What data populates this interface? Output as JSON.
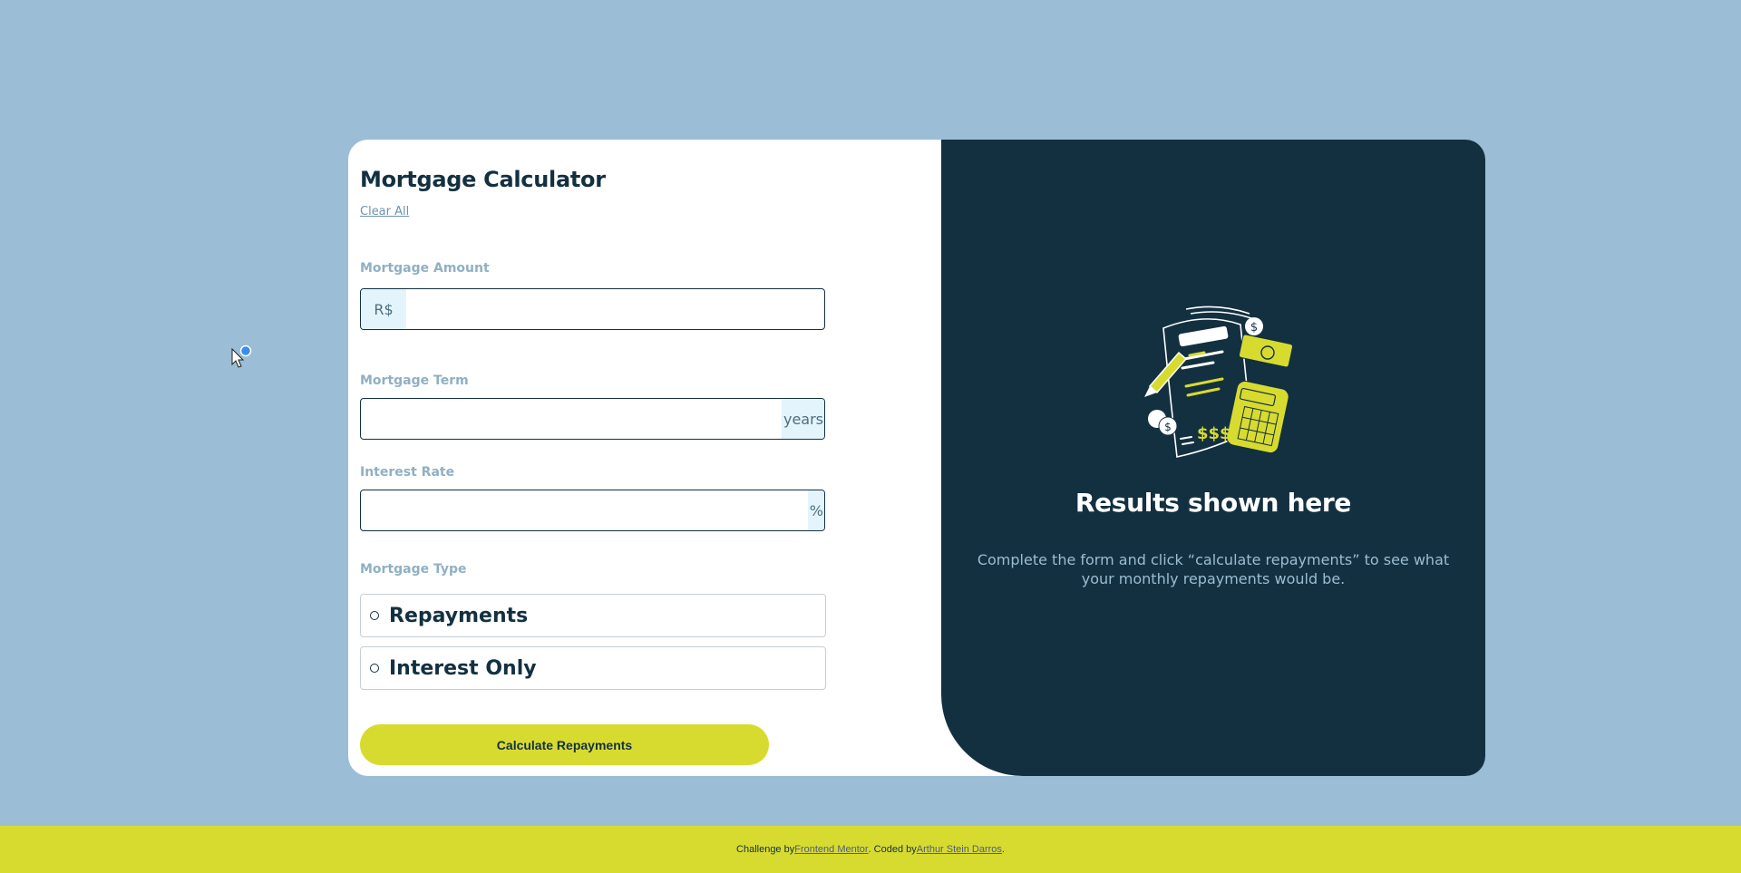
{
  "form": {
    "title": "Mortgage Calculator",
    "clear_label": "Clear All",
    "amount": {
      "label": "Mortgage Amount",
      "prefix": "R$",
      "value": ""
    },
    "term": {
      "label": "Mortgage Term",
      "suffix": "years",
      "value": ""
    },
    "rate": {
      "label": "Interest Rate",
      "suffix": "%",
      "value": ""
    },
    "type": {
      "label": "Mortgage Type",
      "options": [
        {
          "label": "Repayments",
          "selected": false
        },
        {
          "label": "Interest Only",
          "selected": false
        }
      ]
    },
    "submit_label": "Calculate Repayments"
  },
  "results": {
    "title": "Results shown here",
    "description": "Complete the form and click “calculate repayments” to see what your monthly repayments would be."
  },
  "footer": {
    "prefix": "Challenge by",
    "challenge_link": "Frontend Mentor",
    "middle": ". Coded by",
    "author_link": "Arthur Stein Darros",
    "suffix": "."
  },
  "colors": {
    "page_bg": "#9bbdd6",
    "dark": "#133041",
    "lime": "#d8db2f",
    "prefix_bg": "#e4f4fd"
  },
  "icons": [
    "illustration-empty",
    "cursor-pointer"
  ]
}
